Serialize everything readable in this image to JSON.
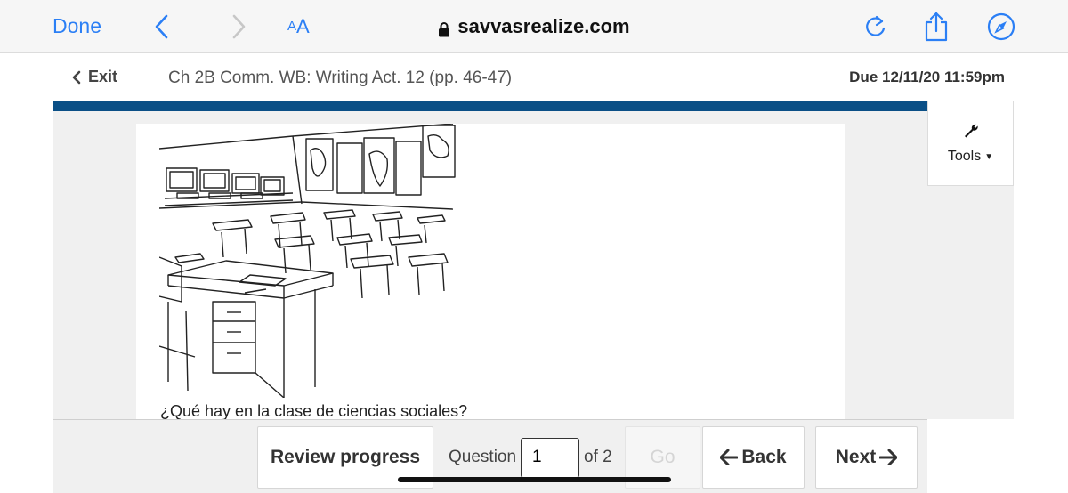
{
  "safari": {
    "done_label": "Done",
    "text_size_small": "A",
    "text_size_large": "A",
    "url": "savvasrealize.com",
    "accent_color": "#2b7ff5"
  },
  "header": {
    "exit_label": "Exit",
    "assignment_title": "Ch 2B Comm. WB: Writing Act. 12 (pp. 46-47)",
    "due_label": "Due 12/11/20 11:59pm",
    "band_color": "#0a4f86"
  },
  "tools": {
    "label": "Tools"
  },
  "content": {
    "question_text": "¿Qué hay en la clase de ciencias sociales?"
  },
  "bottom_nav": {
    "review_label": "Review progress",
    "question_label": "Question",
    "question_value": "1",
    "of_label": "of 2",
    "go_label": "Go",
    "back_label": "Back",
    "next_label": "Next"
  }
}
